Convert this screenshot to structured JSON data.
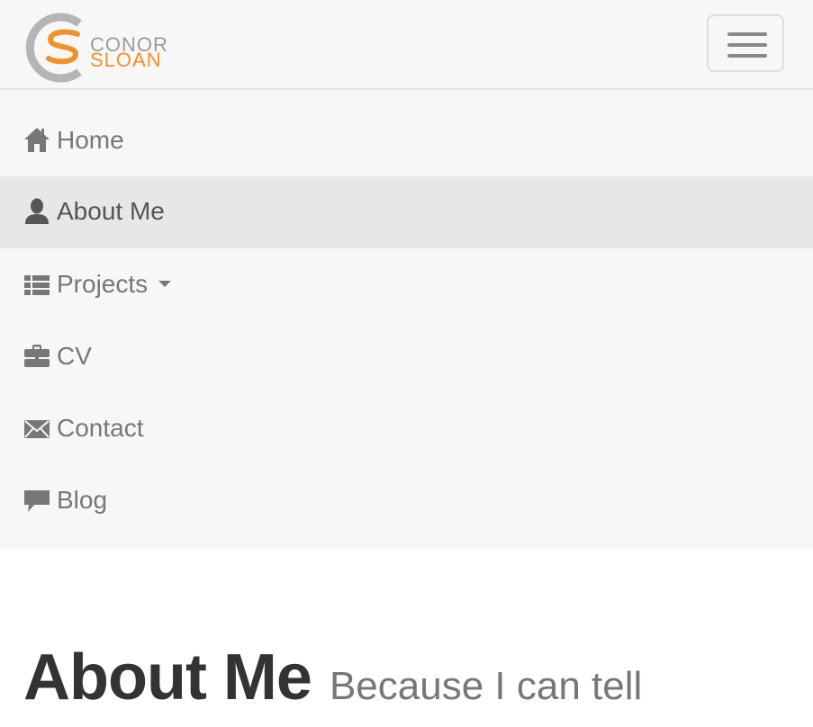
{
  "brand": {
    "name_line1": "CONOR",
    "name_line2": "SLOAN",
    "colors": {
      "primary_gray": "#9b9b9b",
      "accent_orange": "#f0922c"
    }
  },
  "navbar": {
    "toggle_icon": "hamburger-icon",
    "items": [
      {
        "label": "Home",
        "icon": "home-icon",
        "active": false
      },
      {
        "label": "About Me",
        "icon": "user-icon",
        "active": true
      },
      {
        "label": "Projects",
        "icon": "list-icon",
        "active": false,
        "has_dropdown": true
      },
      {
        "label": "CV",
        "icon": "briefcase-icon",
        "active": false
      },
      {
        "label": "Contact",
        "icon": "envelope-icon",
        "active": false
      },
      {
        "label": "Blog",
        "icon": "comment-icon",
        "active": false
      }
    ]
  },
  "page": {
    "title": "About Me",
    "subtitle": "Because I can tell"
  }
}
